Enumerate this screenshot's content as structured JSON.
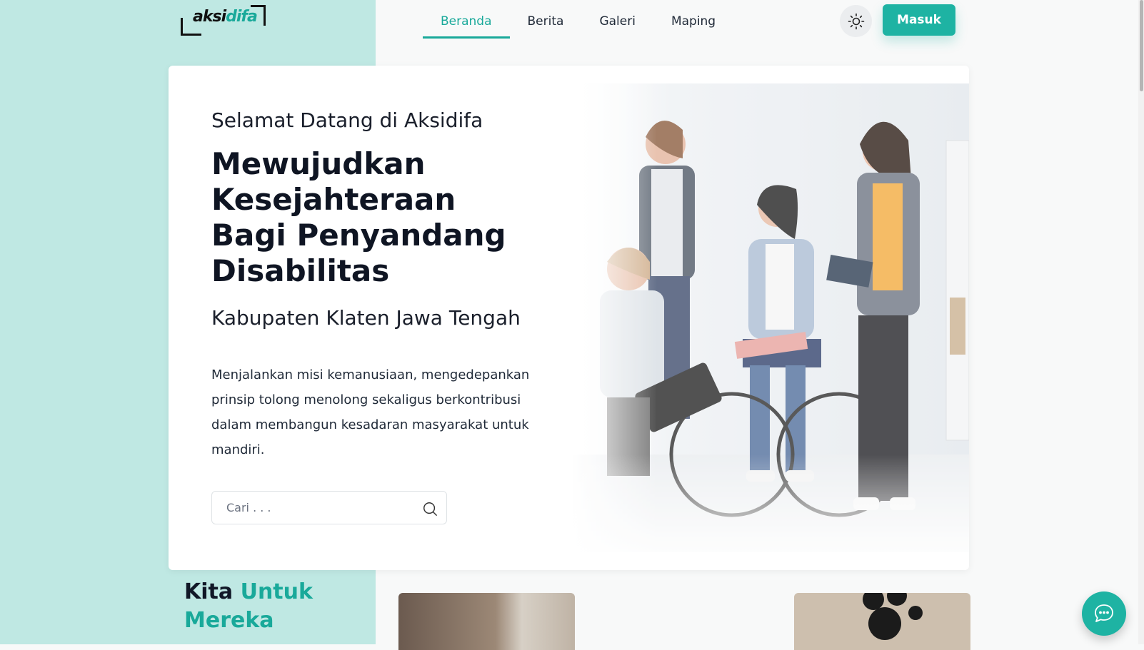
{
  "header": {
    "logo": {
      "part1": "aksi",
      "part2": "difa"
    },
    "nav": [
      {
        "label": "Beranda",
        "active": true
      },
      {
        "label": "Berita",
        "active": false
      },
      {
        "label": "Galeri",
        "active": false
      },
      {
        "label": "Maping",
        "active": false
      }
    ],
    "theme_toggle_icon": "sun-icon",
    "login_label": "Masuk"
  },
  "hero": {
    "welcome": "Selamat Datang di Aksidifa",
    "headline": "Mewujudkan Kesejahteraan Bagi Penyandang Disabilitas",
    "region": "Kabupaten Klaten Jawa Tengah",
    "description": "Menjalankan misi kemanusiaan, mengedepankan prinsip tolong menolong sekaligus berkontribusi dalam membangun kesadaran masyarakat untuk mandiri.",
    "search_placeholder": "Cari . . .",
    "search_icon": "search-icon"
  },
  "section": {
    "title_line1": "Kita",
    "title_accent1": "Untuk",
    "title_accent2": "Mereka"
  },
  "colors": {
    "accent": "#1eb3a3",
    "left_band": "#bfe8e3"
  },
  "chat_icon": "chat-bubble-icon"
}
